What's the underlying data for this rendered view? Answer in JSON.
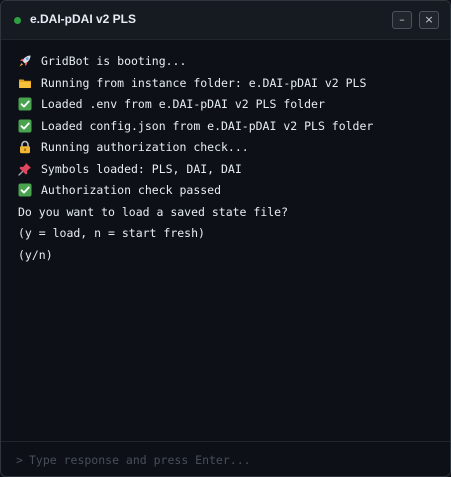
{
  "window": {
    "title": "e.DAI-pDAI v2 PLS",
    "minimize_label": "–",
    "close_label": "×",
    "status_color": "#2ea043"
  },
  "terminal": {
    "lines": [
      {
        "icon": "rocket-icon",
        "text": "GridBot is booting..."
      },
      {
        "icon": "folder-icon",
        "text": "Running from instance folder: e.DAI-pDAI v2 PLS"
      },
      {
        "icon": "check-icon",
        "text": "Loaded .env from e.DAI-pDAI v2 PLS folder"
      },
      {
        "icon": "check-icon",
        "text": "Loaded config.json from e.DAI-pDAI v2 PLS folder"
      },
      {
        "icon": "lock-icon",
        "text": "Running authorization check..."
      },
      {
        "icon": "pushpin-icon",
        "text": "Symbols loaded: PLS, DAI, DAI"
      },
      {
        "icon": "check-icon",
        "text": "Authorization check passed"
      },
      {
        "icon": "",
        "text": "Do you want to load a saved state file?"
      },
      {
        "icon": "",
        "text": "(y = load, n = start fresh)"
      },
      {
        "icon": "",
        "text": "(y/n)"
      }
    ]
  },
  "input": {
    "prompt_symbol": ">",
    "placeholder": "Type response and press Enter..."
  }
}
